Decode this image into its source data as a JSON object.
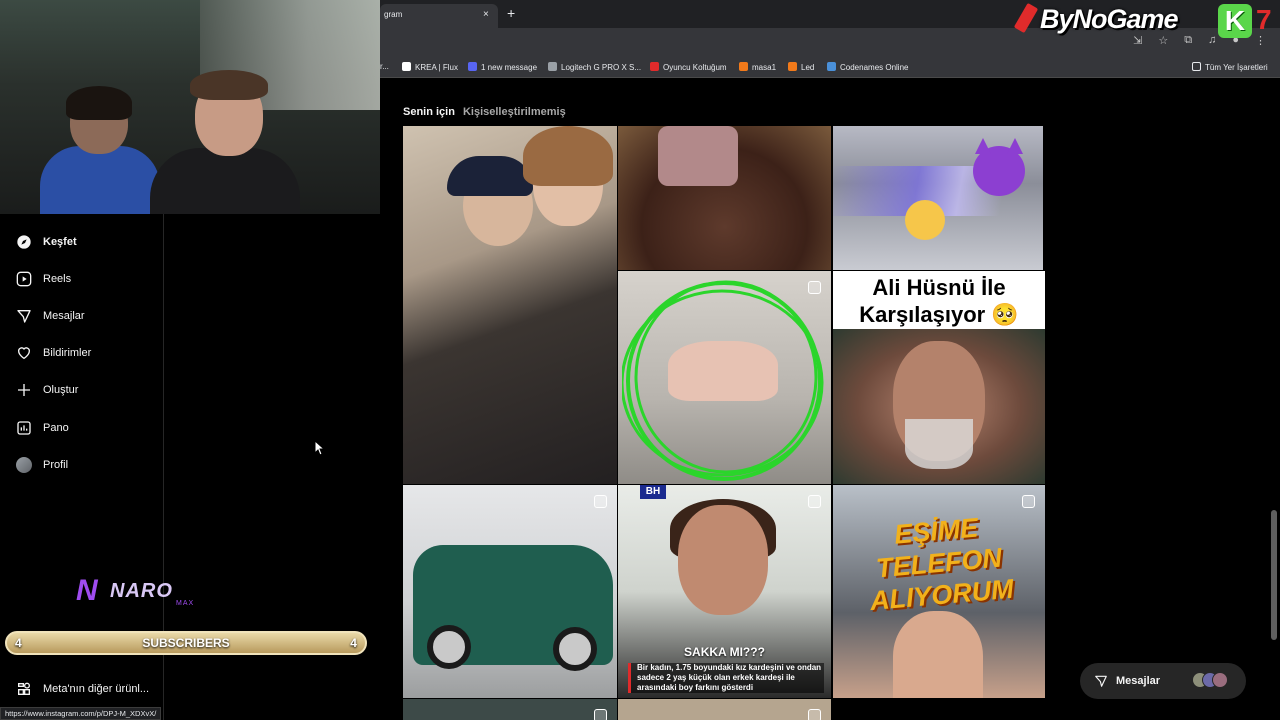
{
  "browser": {
    "tab_title": "gram",
    "tab_close": "×",
    "new_tab": "+",
    "bookmarks": [
      {
        "label": "r...",
        "color": "#5f6368"
      },
      {
        "label": "KREA | Flux",
        "color": "#000000"
      },
      {
        "label": "1 new message",
        "color": "#5865f2"
      },
      {
        "label": "Logitech G PRO X S...",
        "color": "#9aa0a6"
      },
      {
        "label": "Oyuncu Koltuğum",
        "color": "#e02b2b"
      },
      {
        "label": "masa1",
        "color": "#f27a1a"
      },
      {
        "label": "Led",
        "color": "#f27a1a"
      },
      {
        "label": "Codenames Online",
        "color": "#4a90d9"
      }
    ],
    "all_bookmarks": "Tüm Yer İşaretleri",
    "status_url": "https://www.instagram.com/p/DPJ-M_XDXvX/"
  },
  "overlay": {
    "brand": "ByNoGame",
    "k_badge": "K",
    "seven": "7",
    "naro_logo": "NARO",
    "naro_sub": "MAX",
    "subs_left": "4",
    "subs_label": "SUBSCRIBERS",
    "subs_right": "4"
  },
  "sidebar": {
    "items": [
      {
        "label": "Keşfet",
        "icon": "compass-icon",
        "active": true
      },
      {
        "label": "Reels",
        "icon": "reels-icon"
      },
      {
        "label": "Mesajlar",
        "icon": "send-icon"
      },
      {
        "label": "Bildirimler",
        "icon": "heart-icon"
      },
      {
        "label": "Oluştur",
        "icon": "plus-icon"
      },
      {
        "label": "Pano",
        "icon": "chart-icon"
      },
      {
        "label": "Profil",
        "icon": "avatar"
      }
    ],
    "meta_link": "Meta'nın diğer ürünl..."
  },
  "feed": {
    "tab_active": "Senin için",
    "tab_other": "Kişiselleştirilmemiş",
    "tiles": {
      "t5_title": "Ali Hüsnü İle Karşılaşıyor 🥺",
      "t7_badge": "BH",
      "t7_title": "SAKKA MI???",
      "t7_desc": "Bir kadın, 1.75 boyundaki kız kardeşini ve ondan sadece 2 yaş küçük olan erkek kardeşi ile arasındaki boy farkını gösterdi",
      "t8_title": "EŞİME TELEFON ALIYORUM"
    }
  },
  "messages_pill": {
    "label": "Mesajlar"
  }
}
